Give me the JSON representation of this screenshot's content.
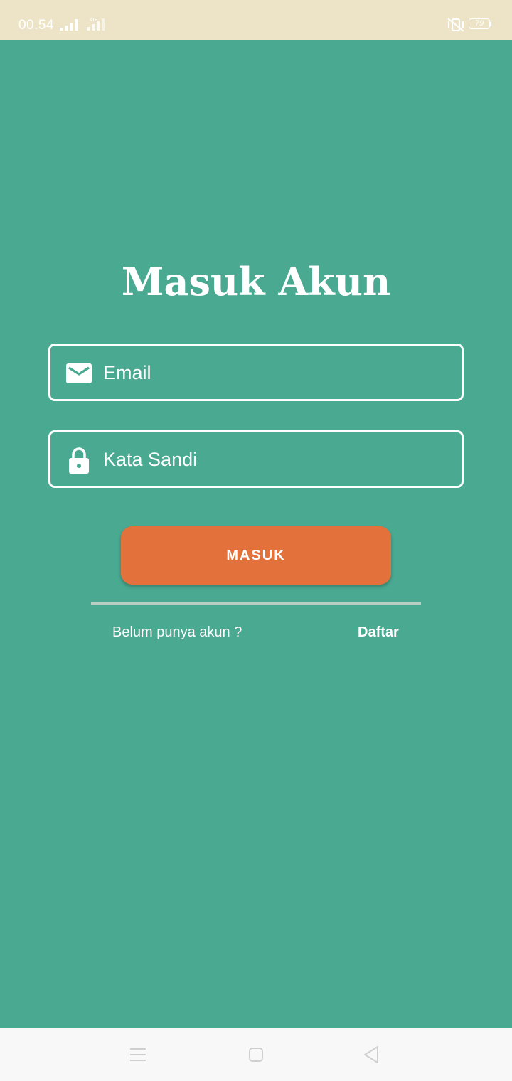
{
  "status_bar": {
    "time": "00.54",
    "battery_level": "79",
    "icons": [
      "signal-icon",
      "signal-4g-icon",
      "vibrate-off-icon",
      "battery-icon"
    ]
  },
  "login": {
    "title": "Masuk Akun",
    "email_placeholder": "Email",
    "password_placeholder": "Kata Sandi",
    "submit_label": "MASUK",
    "no_account_text": "Belum punya akun ?",
    "register_label": "Daftar"
  },
  "colors": {
    "background": "#49a991",
    "status_bar": "#ede4c8",
    "button": "#e2713c",
    "text": "#ffffff",
    "divider": "#b9cfc3",
    "nav_bar": "#f8f8f8"
  },
  "nav_bar": {
    "icons": [
      "menu-icon",
      "home-icon",
      "back-icon"
    ]
  }
}
